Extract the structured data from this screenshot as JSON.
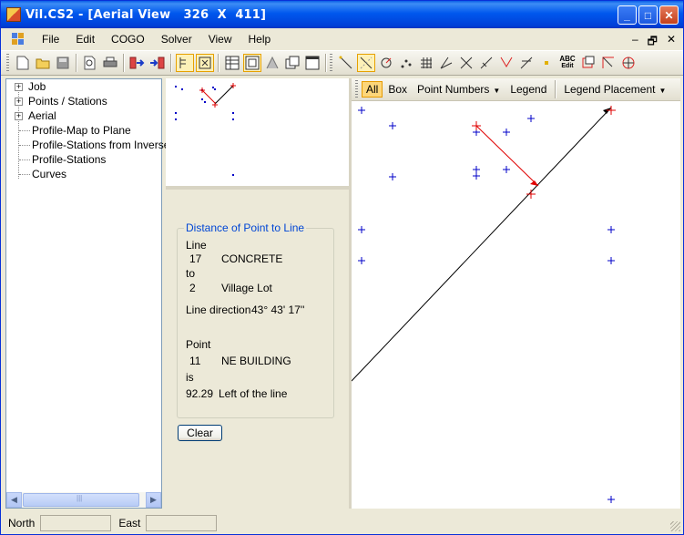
{
  "window": {
    "title": "Vil.CS2 - [Aerial View   326  X  411]",
    "minimize_glyph": "_",
    "maximize_glyph": "□",
    "close_glyph": "✕"
  },
  "menu": {
    "items": [
      "File",
      "Edit",
      "COGO",
      "Solver",
      "View",
      "Help"
    ],
    "mdi_minimize": "–",
    "mdi_restore": "🗗",
    "mdi_close": "✕"
  },
  "toolbar": {
    "icons": [
      "new-icon",
      "open-icon",
      "save-icon",
      "print-preview-icon",
      "print-icon",
      "import-icon",
      "export-icon",
      "text-edit-icon",
      "zoom-extents-icon",
      "table-icon",
      "pane-icon",
      "road-icon",
      "copy-window-icon",
      "window-icon",
      "line-icon",
      "dimension-line-icon",
      "curve-icon",
      "points-icon",
      "grid-icon",
      "angle-icon",
      "intersect-icon",
      "diagonal-icon",
      "offset-icon",
      "perpendicular-icon",
      "point-icon",
      "abc-edit-icon",
      "frame-icon",
      "arc-corner-icon",
      "circle-quarter-icon"
    ],
    "abc_label": "ABC",
    "edit_label": "Edit"
  },
  "tree": {
    "expandable": [
      {
        "label": "Job"
      },
      {
        "label": "Points / Stations"
      },
      {
        "label": "Aerial"
      }
    ],
    "leaves": [
      {
        "label": "Profile-Map to Plane"
      },
      {
        "label": "Profile-Stations from Inverse"
      },
      {
        "label": "Profile-Stations"
      },
      {
        "label": "Curves"
      }
    ],
    "plus": "+",
    "scroll_left": "◀",
    "scroll_right": "▶",
    "scroll_grip": "|||"
  },
  "result": {
    "group_title": "Distance of Point to Line",
    "line_label": "Line",
    "from_num": "17",
    "from_name": "CONCRETE",
    "to_label": "to",
    "to_num": "2",
    "to_name": "Village Lot",
    "direction_label": "Line direction",
    "direction_value": "43° 43' 17''",
    "point_label": "Point",
    "point_num": "11",
    "point_name": "NE BUILDING",
    "is_label": "is",
    "distance": "92.29",
    "side": "Left of the line",
    "clear_label": "Clear"
  },
  "aerial_toolbar": {
    "all": "All",
    "box": "Box",
    "point_numbers": "Point Numbers",
    "legend": "Legend",
    "legend_placement": "Legend Placement",
    "dropdown_glyph": "▼"
  },
  "status": {
    "north_label": "North",
    "north_value": "",
    "east_label": "East",
    "east_value": ""
  },
  "colors": {
    "point": "#0000c8",
    "highlight": "#e00000",
    "line": "#000000",
    "title_blue": "#0046d5"
  }
}
